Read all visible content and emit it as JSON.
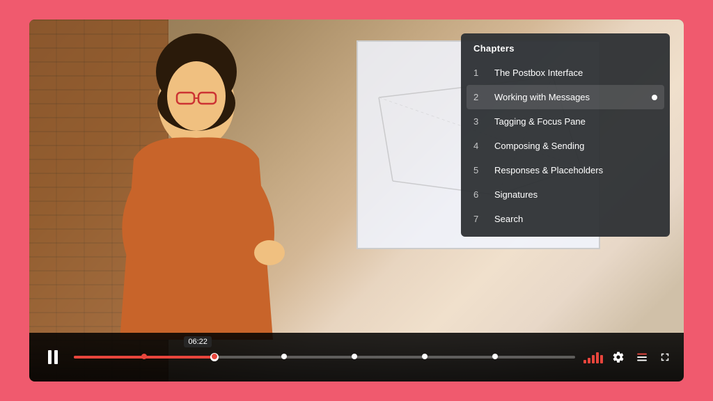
{
  "colors": {
    "bg": "#f05a6e",
    "controlsBg": "rgba(0,0,0,0.9)",
    "chaptersBg": "rgba(45,48,52,0.95)",
    "progressActive": "#e8453c",
    "accent": "#e8453c"
  },
  "video": {
    "currentTime": "06:22",
    "progressPercent": 28
  },
  "controls": {
    "pause_label": "Pause",
    "settings_label": "Settings",
    "chapters_label": "Chapters",
    "fullscreen_label": "Fullscreen"
  },
  "chapters": {
    "header": "Chapters",
    "items": [
      {
        "num": "1",
        "title": "The Postbox Interface",
        "active": false
      },
      {
        "num": "2",
        "title": "Working with Messages",
        "active": true
      },
      {
        "num": "3",
        "title": "Tagging & Focus Pane",
        "active": false
      },
      {
        "num": "4",
        "title": "Composing & Sending",
        "active": false
      },
      {
        "num": "5",
        "title": "Responses & Placeholders",
        "active": false
      },
      {
        "num": "6",
        "title": "Signatures",
        "active": false
      },
      {
        "num": "7",
        "title": "Search",
        "active": false
      }
    ]
  },
  "progressDots": [
    {
      "position": 14,
      "color": "red"
    },
    {
      "position": 28,
      "color": "red"
    },
    {
      "position": 42,
      "color": "white"
    },
    {
      "position": 56,
      "color": "white"
    },
    {
      "position": 70,
      "color": "white"
    },
    {
      "position": 84,
      "color": "white"
    }
  ]
}
